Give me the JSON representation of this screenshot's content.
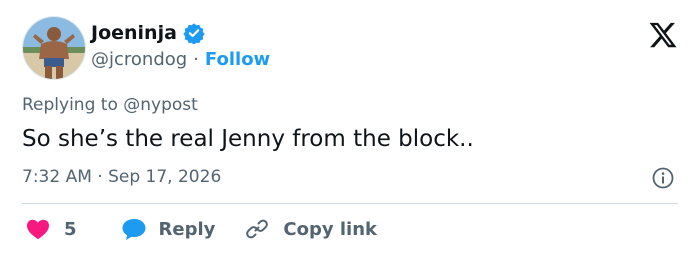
{
  "author": {
    "display_name": "Joeninja",
    "handle": "@jcrondog",
    "separator": "·",
    "follow_label": "Follow",
    "verified": true
  },
  "tweet": {
    "replying_to": "Replying to @nypost",
    "text": "So she’s the real Jenny from the block..",
    "time": "7:32 AM",
    "date_separator": "·",
    "date": "Sep 17, 2026"
  },
  "actions": {
    "likes": "5",
    "reply_label": "Reply",
    "copy_link_label": "Copy link"
  },
  "icons": {
    "brand": "x-logo",
    "verified": "verified-badge-icon",
    "info": "info-icon",
    "like": "heart-icon",
    "reply": "reply-bubble-icon",
    "copy": "link-icon"
  },
  "colors": {
    "accent": "#1d9bf0",
    "like": "#f91880",
    "text": "#0f1419",
    "secondary": "#536471"
  }
}
